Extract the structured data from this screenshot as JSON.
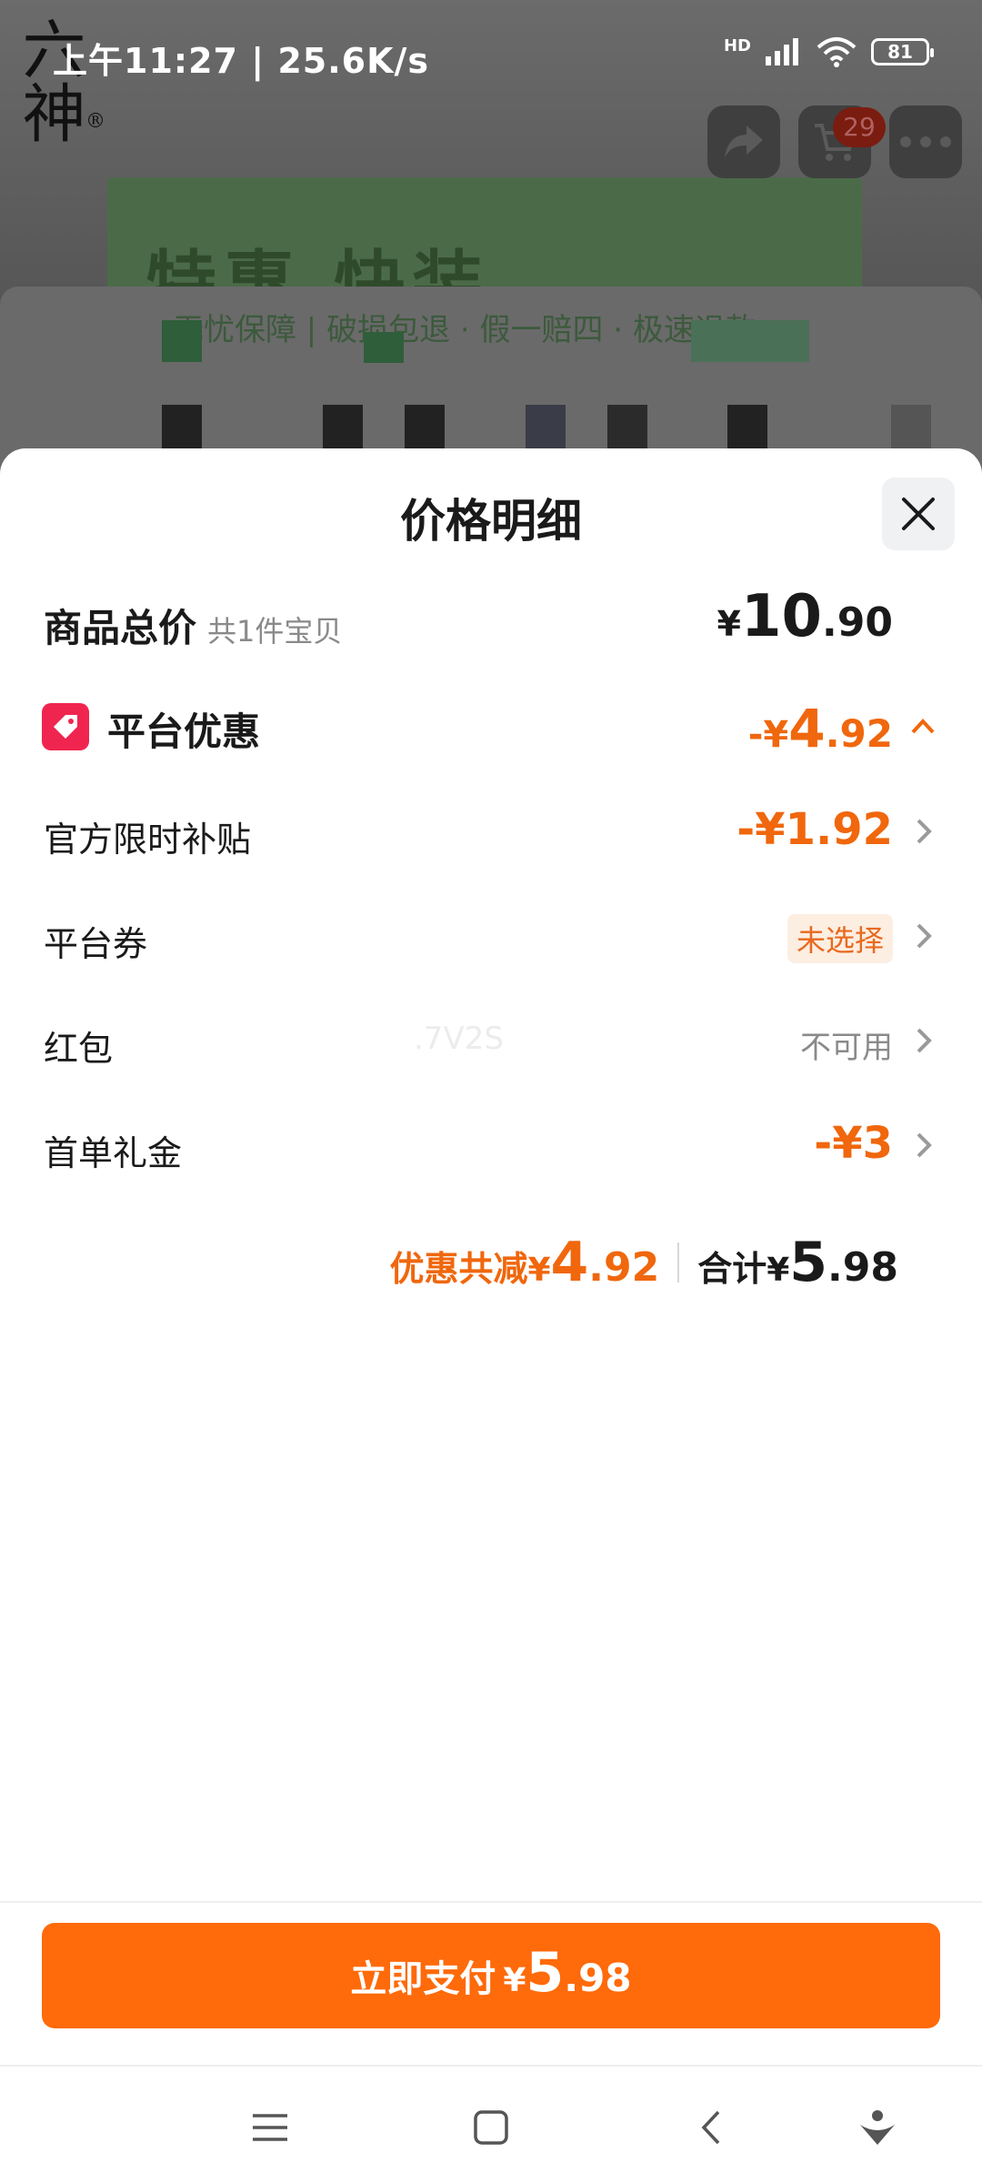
{
  "status_bar": {
    "time": "上午11:27",
    "speed": "25.6K/s",
    "network": "HD",
    "battery": "81"
  },
  "background": {
    "logo_text": "六神",
    "banner_text": "特惠 快装",
    "card_text": "无忧保障 | 破损包退 · 假一赔四 · 极速退款",
    "cart_count": "29"
  },
  "sheet": {
    "title": "价格明细",
    "rows": [
      {
        "label": "商品总价",
        "sub": "共1件宝贝",
        "value_symbol": "¥",
        "value_int": "10",
        "value_dec": ".90"
      },
      {
        "label": "平台优惠",
        "value_symbol": "-¥",
        "value_int": "4",
        "value_dec": ".92"
      },
      {
        "label": "官方限时补贴",
        "value": "-¥1.92"
      },
      {
        "label": "平台券",
        "value": "未选择"
      },
      {
        "label": "红包",
        "value": "不可用"
      },
      {
        "label": "首单礼金",
        "value": "-¥3"
      }
    ],
    "watermark": ".7V2S",
    "summary": {
      "discount_label": "优惠共减",
      "discount_symbol": "¥",
      "discount_int": "4",
      "discount_dec": ".92",
      "total_label": "合计",
      "total_symbol": "¥",
      "total_int": "5",
      "total_dec": ".98"
    }
  },
  "pay_button": {
    "label": "立即支付",
    "symbol": "¥",
    "int": "5",
    "dec": ".98"
  },
  "colors": {
    "accent": "#ff6a0a",
    "discount": "#f0670d",
    "tag_red": "#f0254f"
  }
}
